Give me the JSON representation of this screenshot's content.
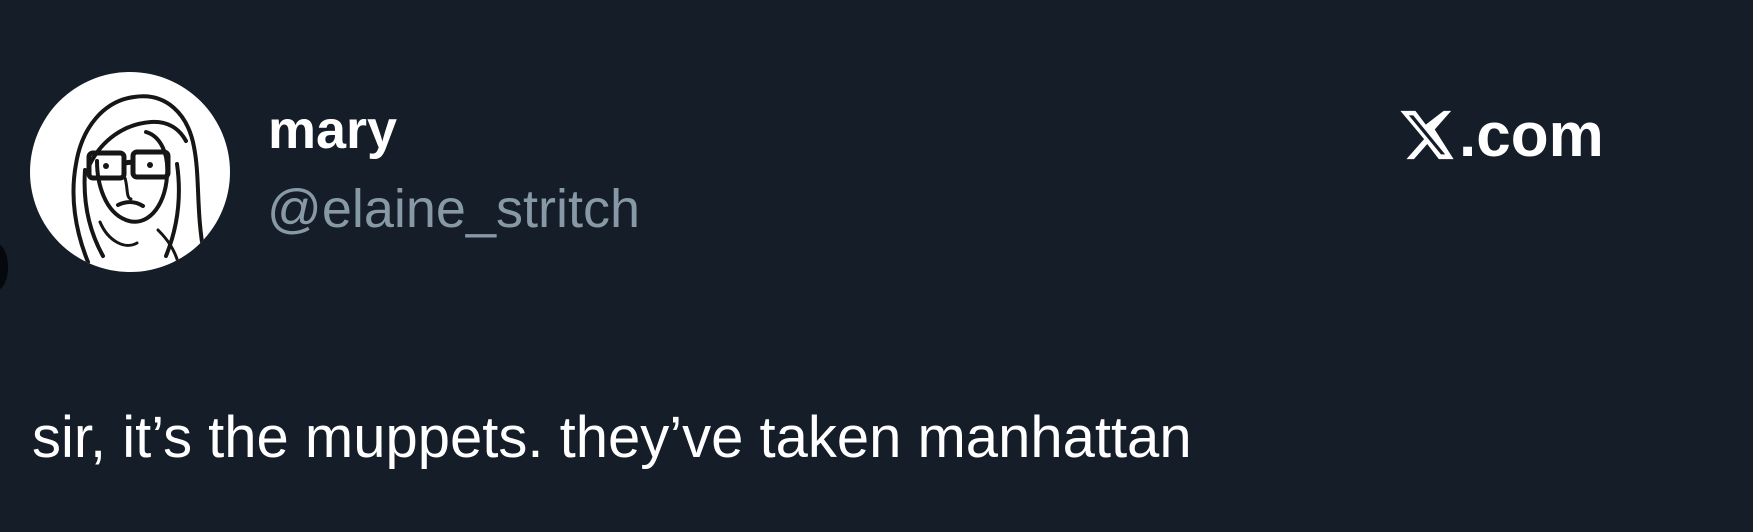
{
  "tweet": {
    "display_name": "mary",
    "handle": "@elaine_stritch",
    "brand_text": ".com",
    "text": "sir, it’s the muppets. they’ve taken manhattan"
  },
  "icons": {
    "brand": "x-logo-icon",
    "avatar": "sketched-face-avatar"
  },
  "colors": {
    "background": "#151d29",
    "primary_text": "#ffffff",
    "secondary_text": "#8899a6",
    "avatar_background": "#ffffff"
  }
}
